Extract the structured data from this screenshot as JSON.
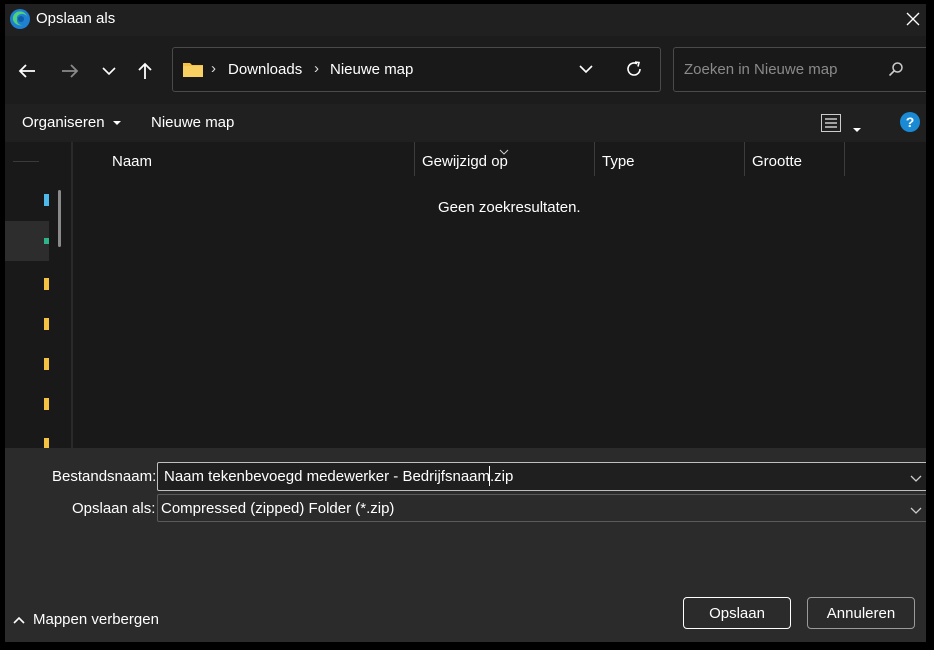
{
  "window": {
    "title": "Opslaan als"
  },
  "address": {
    "crumbs": [
      "Downloads",
      "Nieuwe map"
    ]
  },
  "search": {
    "placeholder": "Zoeken in Nieuwe map"
  },
  "toolbar": {
    "organize_label": "Organiseren",
    "new_folder_label": "Nieuwe map"
  },
  "file_list": {
    "columns": [
      "Naam",
      "Gewijzigd op",
      "Type",
      "Grootte"
    ],
    "empty_message": "Geen zoekresultaten."
  },
  "footer": {
    "filename_label": "Bestandsnaam:",
    "filename_value": "Naam tekenbevoegd medewerker - Bedrijfsnaam.zip",
    "filetype_label": "Opslaan als:",
    "filetype_value": "Compressed (zipped) Folder (*.zip)",
    "hide_folders_label": "Mappen verbergen",
    "save_label": "Opslaan",
    "cancel_label": "Annuleren"
  },
  "colors": {
    "accent": "#1a8ad4",
    "folder": "#f5c244",
    "background": "#202020"
  }
}
